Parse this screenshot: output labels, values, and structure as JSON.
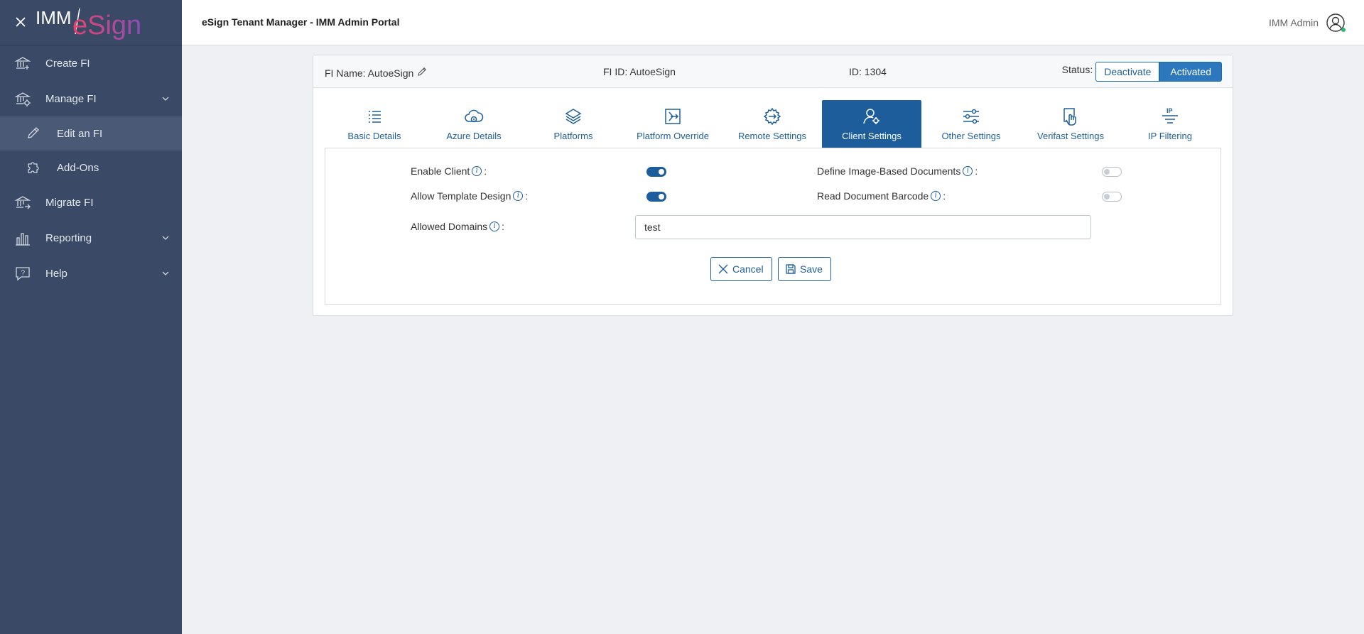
{
  "app": {
    "title": "eSign Tenant Manager - IMM Admin Portal",
    "user": "IMM Admin"
  },
  "logo": {
    "part1": "IMM",
    "part2": "eSign"
  },
  "sidebar": {
    "items": [
      {
        "label": "Create FI",
        "icon": "bank-plus-icon"
      },
      {
        "label": "Manage FI",
        "icon": "bank-gear-icon"
      },
      {
        "label": "Edit an FI",
        "icon": "pencil-icon",
        "active": true
      },
      {
        "label": "Add-Ons",
        "icon": "puzzle-icon"
      },
      {
        "label": "Migrate FI",
        "icon": "bank-arrow-icon"
      },
      {
        "label": "Reporting",
        "icon": "bar-chart-icon"
      },
      {
        "label": "Help",
        "icon": "help-bubble-icon"
      }
    ]
  },
  "fi": {
    "name_label": "FI Name: AutoeSign",
    "fiid_label": "FI ID: AutoeSign",
    "id_label": "ID: 1304",
    "status_label": "Status:",
    "deactivate_label": "Deactivate",
    "activated_label": "Activated"
  },
  "tabs": [
    {
      "label": "Basic Details",
      "icon": "list-icon"
    },
    {
      "label": "Azure Details",
      "icon": "cloud-icon"
    },
    {
      "label": "Platforms",
      "icon": "layers-icon"
    },
    {
      "label": "Platform Override",
      "icon": "override-icon"
    },
    {
      "label": "Remote Settings",
      "icon": "remote-gear-icon"
    },
    {
      "label": "Client Settings",
      "icon": "user-gear-icon",
      "active": true
    },
    {
      "label": "Other Settings",
      "icon": "sliders-icon"
    },
    {
      "label": "Verifast Settings",
      "icon": "hand-touch-icon"
    },
    {
      "label": "IP Filtering",
      "icon": "ip-filter-icon"
    }
  ],
  "client_settings": {
    "enable_client": {
      "label": "Enable Client",
      "value": true
    },
    "allow_template_design": {
      "label": "Allow Template Design",
      "value": true
    },
    "define_image_based_documents": {
      "label": "Define Image-Based Documents",
      "value": false
    },
    "read_document_barcode": {
      "label": "Read Document Barcode",
      "value": false
    },
    "allowed_domains": {
      "label": "Allowed Domains",
      "value": "test"
    },
    "colon": ":",
    "info_glyph": "i"
  },
  "actions": {
    "cancel_label": "Cancel",
    "save_label": "Save"
  },
  "colors": {
    "sidebar": "#3a4a66",
    "primary": "#1d5d9b",
    "accent_logo": "#e23e70"
  }
}
